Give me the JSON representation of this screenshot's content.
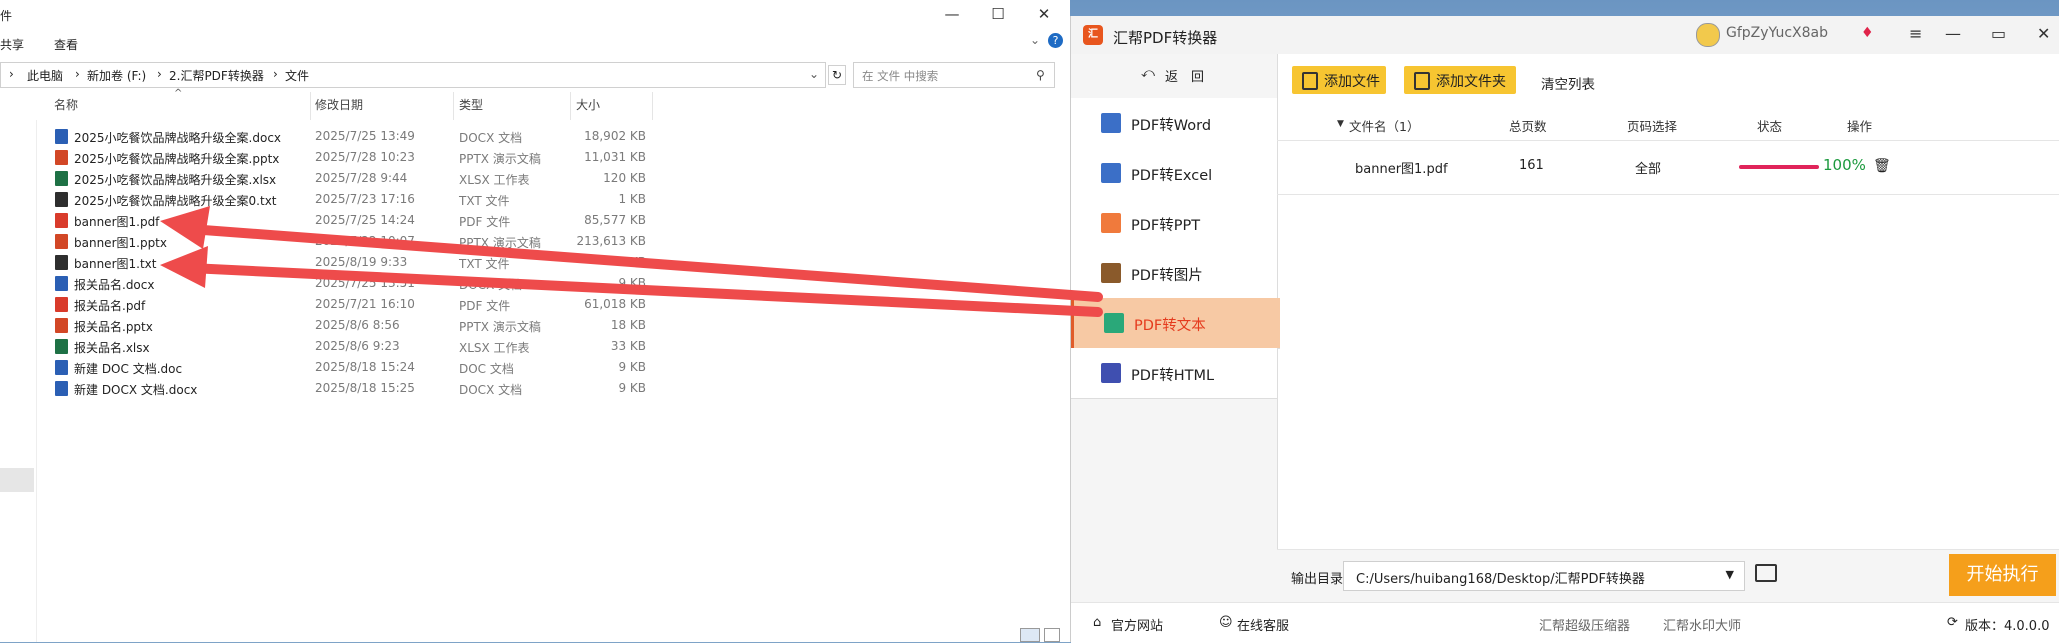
{
  "explorer": {
    "title": "件",
    "menu": [
      "共享",
      "查看"
    ],
    "breadcrumb": [
      "此电脑",
      "新加卷 (F:)",
      "2.汇帮PDF转换器",
      "文件"
    ],
    "search_placeholder": "在 文件 中搜索",
    "columns": [
      "名称",
      "修改日期",
      "类型",
      "大小"
    ],
    "files": [
      {
        "name": "2025小吃餐饮品牌战略升级全案.docx",
        "date": "2025/7/25 13:49",
        "type": "DOCX 文档",
        "size": "18,902 KB",
        "icon": "word-icon",
        "color": "#2b5fb4"
      },
      {
        "name": "2025小吃餐饮品牌战略升级全案.pptx",
        "date": "2025/7/28 10:23",
        "type": "PPTX 演示文稿",
        "size": "11,031 KB",
        "icon": "ppt-icon",
        "color": "#d24726"
      },
      {
        "name": "2025小吃餐饮品牌战略升级全案.xlsx",
        "date": "2025/7/28 9:44",
        "type": "XLSX 工作表",
        "size": "120 KB",
        "icon": "excel-icon",
        "color": "#1e7145"
      },
      {
        "name": "2025小吃餐饮品牌战略升级全案0.txt",
        "date": "2025/7/23 17:16",
        "type": "TXT 文件",
        "size": "1 KB",
        "icon": "txt-icon",
        "color": "#2e2e2e"
      },
      {
        "name": "banner图1.pdf",
        "date": "2025/7/25 14:24",
        "type": "PDF 文件",
        "size": "85,577 KB",
        "icon": "pdf-icon",
        "color": "#d93b2b"
      },
      {
        "name": "banner图1.pptx",
        "date": "2025/7/22 10:07",
        "type": "PPTX 演示文稿",
        "size": "213,613 KB",
        "icon": "ppt-icon",
        "color": "#d24726"
      },
      {
        "name": "banner图1.txt",
        "date": "2025/8/19 9:33",
        "type": "TXT 文件",
        "size": "9 KB",
        "icon": "txt-icon",
        "color": "#2e2e2e"
      },
      {
        "name": "报关品名.docx",
        "date": "2025/7/25 13:51",
        "type": "DOCX 文档",
        "size": "9 KB",
        "icon": "word-icon",
        "color": "#2b5fb4"
      },
      {
        "name": "报关品名.pdf",
        "date": "2025/7/21 16:10",
        "type": "PDF 文件",
        "size": "61,018 KB",
        "icon": "pdf-icon",
        "color": "#d93b2b"
      },
      {
        "name": "报关品名.pptx",
        "date": "2025/8/6 8:56",
        "type": "PPTX 演示文稿",
        "size": "18 KB",
        "icon": "ppt-icon",
        "color": "#d24726"
      },
      {
        "name": "报关品名.xlsx",
        "date": "2025/8/6 9:23",
        "type": "XLSX 工作表",
        "size": "33 KB",
        "icon": "excel-icon",
        "color": "#1e7145"
      },
      {
        "name": "新建 DOC 文档.doc",
        "date": "2025/8/18 15:24",
        "type": "DOC 文档",
        "size": "9 KB",
        "icon": "word-icon",
        "color": "#2b5fb4"
      },
      {
        "name": "新建 DOCX 文档.docx",
        "date": "2025/8/18 15:25",
        "type": "DOCX 文档",
        "size": "9 KB",
        "icon": "word-icon",
        "color": "#2b5fb4"
      }
    ]
  },
  "app": {
    "title": "汇帮PDF转换器",
    "user": "GfpZyYucX8ab",
    "back_label": "返　回",
    "nav": [
      {
        "label": "PDF转Word",
        "icon": "word-icon",
        "color": "#3b6fc7"
      },
      {
        "label": "PDF转Excel",
        "icon": "excel-icon",
        "color": "#3b6fc7"
      },
      {
        "label": "PDF转PPT",
        "icon": "ppt-icon",
        "color": "#f07a3c"
      },
      {
        "label": "PDF转图片",
        "icon": "image-icon",
        "color": "#8a5a2b"
      },
      {
        "label": "PDF转文本",
        "icon": "text-icon",
        "color": "#2aa879"
      },
      {
        "label": "PDF转HTML",
        "icon": "html-icon",
        "color": "#3f4fb0"
      }
    ],
    "toolbar": {
      "add_file": "添加文件",
      "add_folder": "添加文件夹",
      "clear": "清空列表"
    },
    "table": {
      "headers": [
        "文件名（1）",
        "总页数",
        "页码选择",
        "状态",
        "操作"
      ],
      "rows": [
        {
          "name": "banner图1.pdf",
          "pages": "161",
          "range": "全部",
          "progress": "100%"
        }
      ]
    },
    "output": {
      "label": "输出目录:",
      "path": "C:/Users/huibang168/Desktop/汇帮PDF转换器"
    },
    "start_label": "开始执行",
    "status": {
      "site": "官方网站",
      "service": "在线客服",
      "link1": "汇帮超级压缩器",
      "link2": "汇帮水印大师",
      "version": "版本：4.0.0.0"
    }
  }
}
